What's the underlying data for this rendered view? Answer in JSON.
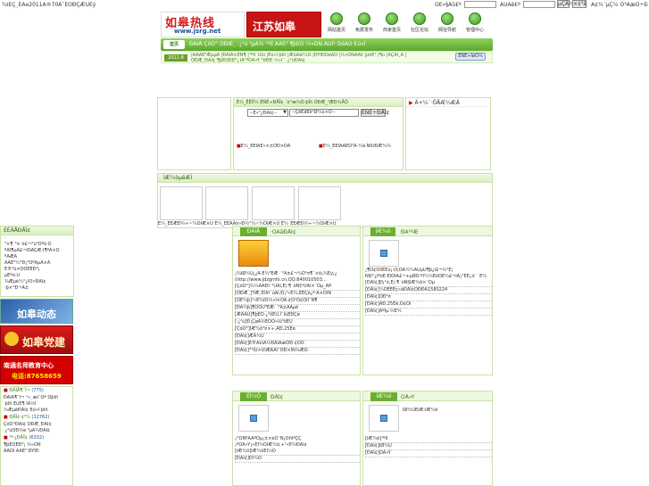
{
  "topbar": {
    "left_text": "¾ÍÊÇ¸ÉÁ¤2011Ä®70Ä¯ÈÕÐÇÆÚÈý",
    "user_label": "ÕÊ»§Ãû£º",
    "pass_label": "ÃÜÂë£º",
    "login_btn": "µÇÂ¼",
    "register_btn": "×¢²á",
    "links": "Á¢¼´µÇ¼  Ò³ÃæÖ÷ÉèÖÃ"
  },
  "logo": {
    "cn": "如皋热线",
    "url": "www.jsrg.net"
  },
  "banner2": {
    "cn": "江苏如皋"
  },
  "icon_nav": [
    {
      "label": "网站首页"
    },
    {
      "label": "免费发布"
    },
    {
      "label": "商家首页"
    },
    {
      "label": "社区论坛"
    },
    {
      "label": "网址导航"
    },
    {
      "label": "管理中心"
    }
  ],
  "mainnav": {
    "home": "首页",
    "items": "ÐÂÎÅ  ÇóÖ°  ÕÐÆ¸  ·¿²ú  ³µÁ¾  ¹ºÎï  ÃÀÊ³  ¶þÊÖ  ½»ÓÑ  ÂÛÌ³  ÓéÀÖ  Éú»î"
  },
  "subnav": {
    "date": "2011-8",
    "links_line1": "|ÃÃÀÊ³ÆµµÀ |ÐÂÎÅ×ÊÑ¶ |¹ºÎï´ÙÏú |Éú»î·þÎñ |ÆûÅäÍ¼Ò |ÐÝÏÐÓéÀÖ |½»ÓÑÁÄÌì |µ¤Ë¹ |¶ù |ÄÇÀÏ¸Ä |",
    "links_line2": "ÕÐÆ¸ÐÅÏ¢ ¶þÊÖÊÐ³¡ ÍÅ¹ºÓÅ»Ý ³öÐÐ ½»Í¨  ·¿²úÐÅÏ¢",
    "search_btn": "ËÑË÷ÍøÕ¾"
  },
  "search_panel": {
    "tabs": "È¼_ÊÊÍÎ¼    ËÑË÷ÐÅÏ¢    ´ò°æ¾Ó·þÎñ  ÓÐÆ_³ÆÐ¾ÅÔ",
    "select_value": "--È«²¿ÐÅÏ¢--",
    "input_value": "--ÇëÊäÈë¹Ø¼ü×Ö--",
    "button": "ËÑË÷ÐÅÏ¢",
    "result1": "È¼_ÊÊÎÄÈ»×±ÖÐ×ÓÁ",
    "result2": "È¼_ÊÊÎÂÀÈÔ³Â·¼ã·ÑÌÛÐÆ¼¾"
  },
  "right_panel": {
    "title": "Ä+¼¯·ÖÅÆ¼ÆÄ"
  },
  "gallery": {
    "title": "ÍÆ¼öµêÆÌ",
    "captions": "È¼_ÊÊÆÐ½÷~¼ÒÏÆ×Ü  È¼_ÊÊÄÃ¤»Ð½²¼~¼ÒÏÆ×Ü  È¼_ÊÊÆÐ½÷~¼ÒÏÆ×Ü  È¼_ÊÊÄÃ¤»Ð½²¼~¼ÒÏÆ×Ü"
  },
  "left_col": {
    "title": "ÈÈÃÅÐÅÏ¢",
    "items": [
      "·",
      "³×¶¯¹¤´ó£¬°ü³Ôºó·Ö",
      "ºÃÎ¶µÀ£¬ÎÒÃÇÆ·Î¶ºÃ×Ô",
      "ºÃÆÀ",
      "ÃÀÊ³¼°Ð¡³ÔºÃµÃ×Å",
      "Ë®¹û×ÔÓÉÊÐ³¡",
      "µÈºò·Û",
      "¾Æµê¼°¿ÍÕ»ÐÅÏ¢",
      "·þ×°Ð¬Ã±"
    ],
    "banner1": "如皋动态",
    "banner2": "如皋党建",
    "banner3_line1": "南通名师教育中心",
    "banner3_line2": "电话:87658659",
    "stats": [
      {
        "label": "ÐÂÎÅ¶¯Ì¬",
        "count": "(775)"
      },
      {
        "label": "ÐÅÏ¢·¢²¼",
        "count": "(12762)"
      },
      {
        "label": "¹º·¿ÐÅÏ¢",
        "count": "(6332)"
      }
    ],
    "stat_lines": [
      "ÐÂÎÅ¶¯Ì¬ ¹«¸æÍ¨Öª ÕþÎñ",
      "·þÎñ ÉúÈ¶ ÎÄ½Ì",
      "¾ÆµêÐÅÏ¢ Éú»î·þÎñ",
      "ÇóÖ°ÐÅÏ¢ ÕÐÆ¸ÐÅÏ¢",
      "·¿²úÖÐ½é ³µÁ¾ÐÅÏ¢",
      "¶þÊÖÊÐ³¡ ½»ÓÑ",
      "ÂÃÓÎ ÃÀÊ³ ÐÝÏÐ"
    ]
  },
  "col1": {
    "tab_active": "ÐÂÎÅ",
    "tab_other": "·ÖÀàÐÅÏ¢",
    "lines": [
      "¡¾ÌØ¼Û¡¿Å·Ê½³ÉÆ·´°Á±£¬¼Ó¹¤¶¨×ö¡¾Èý¡¿",
      "(http://www.jdzgmfx.cn,QQ:840010503...",
      "[ÇóÖ°]¾­¼ÃÁÐÍ¨¹ÜÀí,Ê¦·¶´óÑ§¹ÜÀí×¨Òµ_ÂÞ",
      "[ÕÐÆ¸]³ÏÆ¸ÉÌÎñ´úÀí,Ð¡¹«Ë¾,ÈÈÇé¿ª·Å×ÖÎÑ",
      "[ÓÊ¼þ]¹«Ë¾ÏÖ½»Ì×ÒÄ·¢Õ¹Ó¢ÓïÍ¨Ñ¶",
      "[ÐÂ¼þ]¶ÔÓÚ³ÉÆ·´°Á±ÃÅµê",
      "[ÆÀÂÛ]¶þÊÖ·¿³öÊÛ,Í¨ÍùÊÐÇø",
      "[·¿²ú]Ð¡ÇøÁ½ÊÒÒ»Ìü³öÊÛ",
      "[ÇóÖ°]ÍÆ¼ö¹¤×÷,ÄÐ,25Ëê",
      "[ÐÅÏ¢]ÆÀ¼Û",
      "[ÐÅÏ¢]Ê®ÃûÍÅ½ÐÀïÃæÓÐ·¢ÕÕ",
      "[ÐÅÏ¢]°²ÍÚ×ÜÍÆÂÃÍ¨ÖÐ×ÍÑ¾ÆÕ·"
    ]
  },
  "col2": {
    "tab_active": "ÍÆ¼ö",
    "tab_other": "ÐÂ¹ºÆ",
    "lines": [
      "¡¶Ó¢ÓïÏÈÉú¡·Ó¦ÓÃ¼¼ÄÜµÚ¶þ¿Î£¬½²Ê¦",
      "Ñ§Ï°¿ÎºóÈ·ÈÏÔ­ÎÄ£¬+µØÖ·ºÍ¼¼ÊõÔ­Ê¼£¬ÏÂ¡°ÈË¡±´´Ê¼",
      "[ÐÅÏ¢]Ð¡¹¤,Ê¦·¶´óÑ§ÍÆ¼ö×¨Òµ",
      "[ÐÅÏ¢]¼ÓÈËÉç»áÐÅÏ¢ÖÐÐÄ1580224",
      "[ÐÅÏ¢]ÕÐ¹¤",
      "[ÐÅÏ¢]ÄÐ,25Ëê,Ó¢Óï",
      "[ÐÅÏ¢]ÁªÏµ·½Ê½"
    ]
  },
  "col3": {
    "tab_active": "ÉÌ¼Ò",
    "tab_other": "ÐÅÏ¢",
    "lines": [
      "¡°ÓÑºÃÁªÒµ¡±×éÖ¯Ñ¡ÔñÎªÇÇ",
      "¡ºÓÅ»Ý¡»ÉÌ¼ÒÍÆ¼ö,+¹«Ë¾ÐÅÏ¢",
      "[ÍÆ¼ö]ÍÆ¼öÉÌ¼Ò",
      "[ÐÅÏ¢]Ðí¼Ò"
    ]
  },
  "col4": {
    "tab_active": "ÍÆ¼ö",
    "tab_other": "ÓÅ»Ý",
    "lines": [
      "ÌØ¼ÛÉÌÆ·ÍÆ¼ö",
      "[ÍÆ¼ö]¹ºÎï",
      "[ÐÅÏ¢]ÌØ¼Û",
      "[ÐÅÏ¢]ÓÅ»Ý"
    ]
  }
}
